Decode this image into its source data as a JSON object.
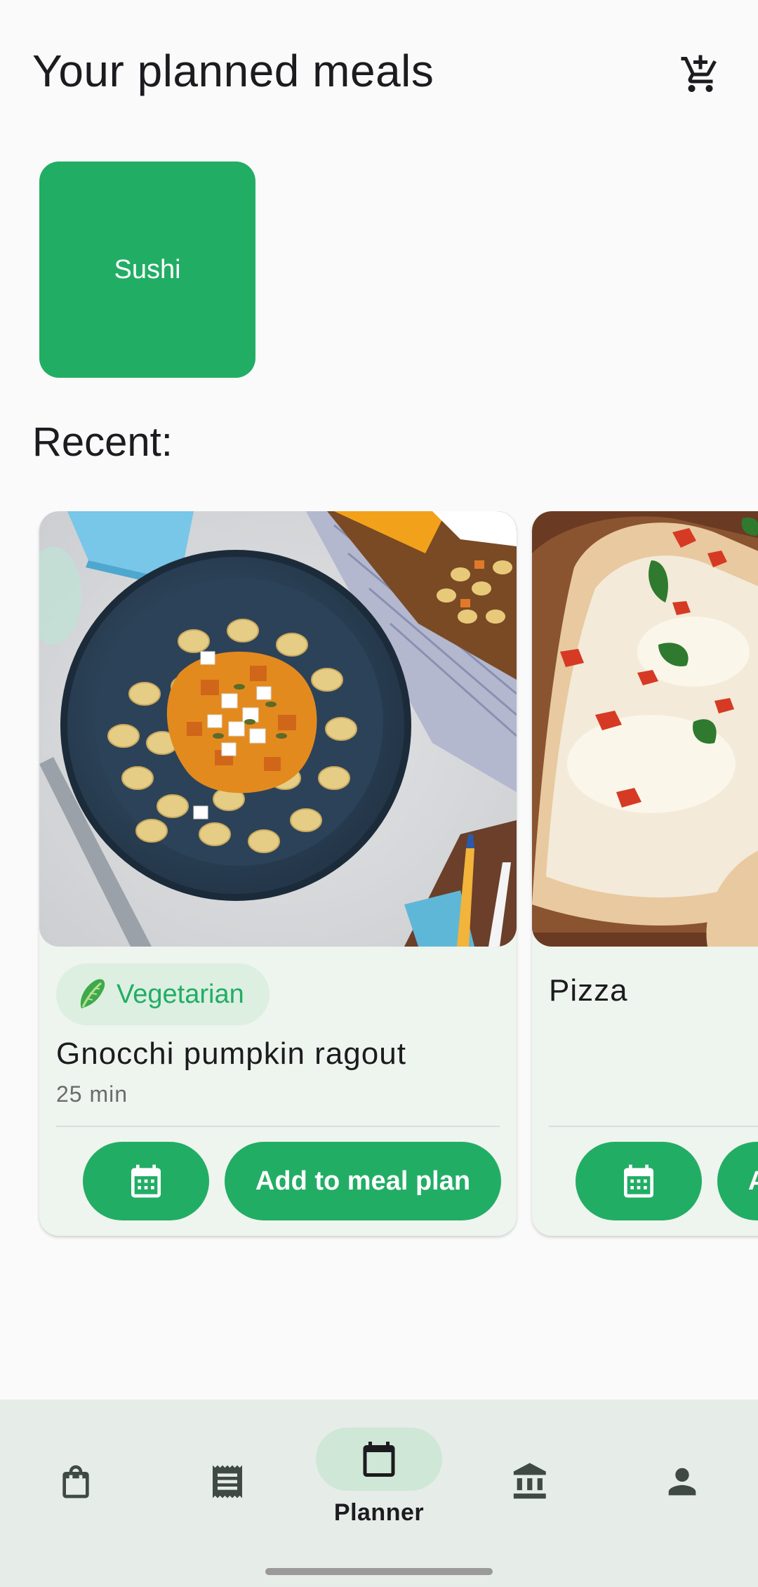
{
  "header": {
    "title": "Your planned meals",
    "cart_icon": "add-shopping-cart-icon"
  },
  "planned_meals": [
    {
      "name": "Sushi",
      "color": "#22ad65"
    }
  ],
  "recent": {
    "title": "Recent:",
    "cards": [
      {
        "image": "gnocchi-plate-image",
        "tag": "Vegetarian",
        "tag_icon": "lettuce-icon",
        "title": "Gnocchi pumpkin ragout",
        "time": "25 min",
        "calendar_icon": "calendar-icon",
        "action_label": "Add to meal plan"
      },
      {
        "image": "pizza-image",
        "title": "Pizza",
        "calendar_icon": "calendar-icon",
        "action_label": "Add to meal plan"
      }
    ]
  },
  "bottom_nav": {
    "items": [
      {
        "icon": "shopping-bag-icon",
        "label": ""
      },
      {
        "icon": "receipt-icon",
        "label": ""
      },
      {
        "icon": "calendar-icon",
        "label": "Planner",
        "active": true
      },
      {
        "icon": "bank-icon",
        "label": ""
      },
      {
        "icon": "person-icon",
        "label": ""
      }
    ]
  },
  "colors": {
    "accent": "#22ad65",
    "background": "#fafafa",
    "card": "#eef4ee",
    "nav": "#e6ece8"
  }
}
